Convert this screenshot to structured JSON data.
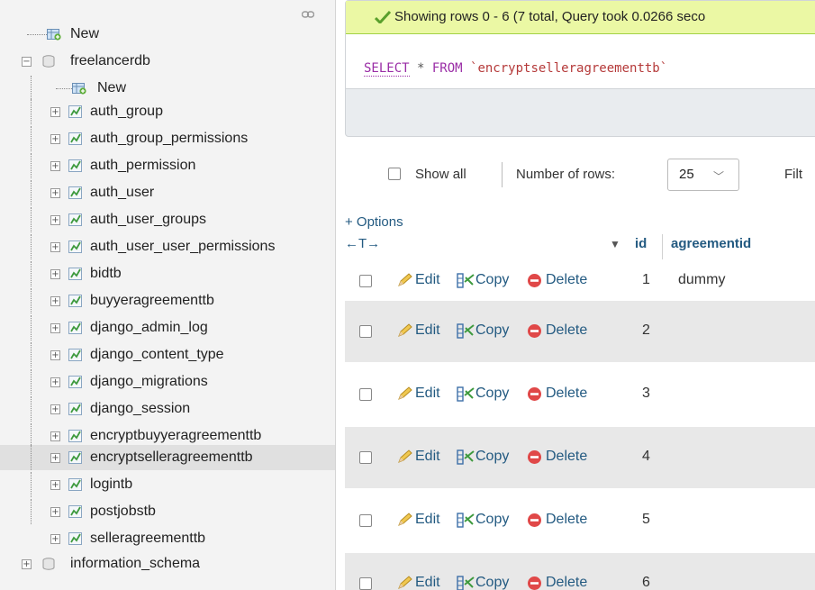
{
  "sidebar": {
    "items": [
      {
        "label": "New",
        "kind": "new",
        "depth": 0
      },
      {
        "label": "freelancerdb",
        "kind": "db",
        "depth": 0,
        "expanded": true
      },
      {
        "label": "New",
        "kind": "new",
        "depth": 1
      },
      {
        "label": "auth_group",
        "kind": "table",
        "depth": 1
      },
      {
        "label": "auth_group_permissions",
        "kind": "table",
        "depth": 1
      },
      {
        "label": "auth_permission",
        "kind": "table",
        "depth": 1
      },
      {
        "label": "auth_user",
        "kind": "table",
        "depth": 1
      },
      {
        "label": "auth_user_groups",
        "kind": "table",
        "depth": 1
      },
      {
        "label": "auth_user_user_permissions",
        "kind": "table",
        "depth": 1
      },
      {
        "label": "bidtb",
        "kind": "table",
        "depth": 1
      },
      {
        "label": "buyyeragreementtb",
        "kind": "table",
        "depth": 1
      },
      {
        "label": "django_admin_log",
        "kind": "table",
        "depth": 1
      },
      {
        "label": "django_content_type",
        "kind": "table",
        "depth": 1
      },
      {
        "label": "django_migrations",
        "kind": "table",
        "depth": 1
      },
      {
        "label": "django_session",
        "kind": "table",
        "depth": 1
      },
      {
        "label": "encryptbuyyeragreementtb",
        "kind": "table",
        "depth": 1
      },
      {
        "label": "encryptselleragreementtb",
        "kind": "table",
        "depth": 1,
        "selected": true
      },
      {
        "label": "logintb",
        "kind": "table",
        "depth": 1
      },
      {
        "label": "postjobstb",
        "kind": "table",
        "depth": 1
      },
      {
        "label": "selleragreementtb",
        "kind": "table",
        "depth": 1
      },
      {
        "label": "information_schema",
        "kind": "db",
        "depth": 0
      }
    ]
  },
  "message": {
    "text": "Showing rows 0 - 6 (7 total, Query took 0.0266 seco",
    "color": "#ebf8a4"
  },
  "sql": {
    "keyword1": "SELECT",
    "star": " * ",
    "keyword2": "FROM",
    "table": " `encryptselleragreementtb`"
  },
  "controls": {
    "show_all_label": "Show all",
    "number_of_rows_label": "Number of rows:",
    "rows_value": "25",
    "filter_label": "Filt"
  },
  "table": {
    "options_link": "+ Options",
    "col_arrows": "←T→",
    "columns": [
      "id",
      "agreementid"
    ],
    "actions": {
      "edit": "Edit",
      "copy": "Copy",
      "delete": "Delete"
    },
    "rows": [
      {
        "id": "1",
        "agreementid": "dummy"
      },
      {
        "id": "2",
        "agreementid": ""
      },
      {
        "id": "3",
        "agreementid": ""
      },
      {
        "id": "4",
        "agreementid": ""
      },
      {
        "id": "5",
        "agreementid": ""
      },
      {
        "id": "6",
        "agreementid": ""
      }
    ]
  },
  "colors": {
    "link": "#235a81",
    "sidebar_bg": "#f3f3f3",
    "row_alt": "#e8e8e8",
    "delete_icon": "#e04848"
  }
}
